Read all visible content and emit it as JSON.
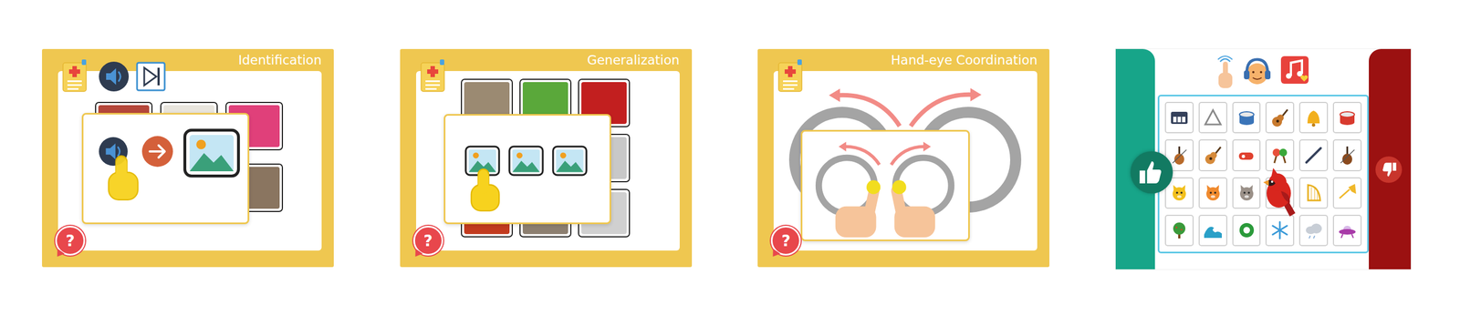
{
  "lessons": [
    {
      "kind": "identification",
      "title": "Identification",
      "help": "?"
    },
    {
      "kind": "generalization",
      "title": "Generalization",
      "help": "?"
    },
    {
      "kind": "coordination",
      "title": "Hand-eye Coordination",
      "help": "?"
    }
  ]
}
